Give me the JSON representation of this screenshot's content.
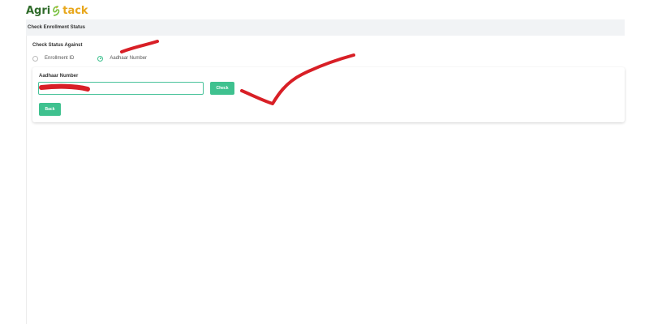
{
  "brand": {
    "part1": "Agri",
    "part2": "tack",
    "leaf_color": "#7ac142",
    "primary_color": "#2f6b2a",
    "accent_color": "#e8a71c"
  },
  "page": {
    "title": "Check Enrollment Status"
  },
  "status": {
    "label": "Check Status Against",
    "options": [
      {
        "label": "Enrollment ID",
        "selected": false
      },
      {
        "label": "Aadhaar Number",
        "selected": true
      }
    ]
  },
  "form": {
    "aadhaar_label": "Aadhaar Number",
    "aadhaar_value": "",
    "check_label": "Check",
    "back_label": "Back"
  },
  "theme": {
    "button_color": "#3fc18f",
    "annotation_color": "#d81f26"
  }
}
